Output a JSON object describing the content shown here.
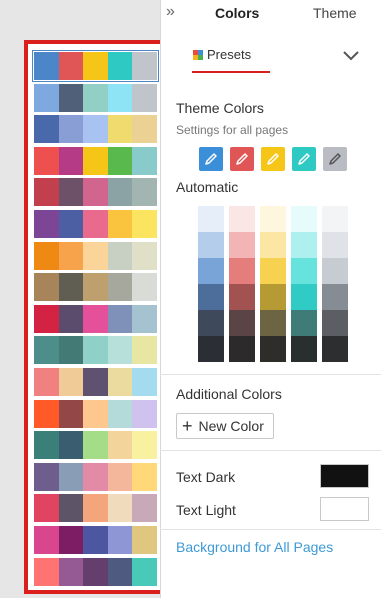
{
  "header": {
    "expand_glyph": "»",
    "tab_colors": "Colors",
    "tab_theme": "Theme"
  },
  "presets": {
    "label": "Presets",
    "icon_colors": [
      "#e84c3d",
      "#3b8fd9",
      "#f2b31b",
      "#4caf50"
    ],
    "rows": [
      [
        "#4a86c8",
        "#e05555",
        "#f5c518",
        "#2ec9c3",
        "#c0c5cc"
      ],
      [
        "#7ea8e0",
        "#4f6078",
        "#92cfc4",
        "#8ee3f5",
        "#c0c5cc"
      ],
      [
        "#4a69aa",
        "#8a9ed6",
        "#a8c3f2",
        "#f0dc6e",
        "#ebd294"
      ],
      [
        "#ee5050",
        "#b53b86",
        "#f5c518",
        "#5ab94c",
        "#89cbca"
      ],
      [
        "#c2404e",
        "#6d5169",
        "#d1658e",
        "#8ba3a4",
        "#a3b5b1"
      ],
      [
        "#7c4595",
        "#4b5fa2",
        "#e96a8c",
        "#fbc43f",
        "#fbe460"
      ],
      [
        "#ee8a14",
        "#f7a34b",
        "#fbd49a",
        "#c7d0c3",
        "#e0e0c8"
      ],
      [
        "#a8845a",
        "#605e52",
        "#bea06e",
        "#a6a89e",
        "#d8dbd6"
      ],
      [
        "#d42342",
        "#5b4c6e",
        "#e4519a",
        "#7f91b9",
        "#a4c2d0"
      ],
      [
        "#4d8e8a",
        "#437a76",
        "#8fd0c9",
        "#b8e0db",
        "#e7e7a3"
      ],
      [
        "#f18080",
        "#f0ca97",
        "#5f5270",
        "#ecdb9e",
        "#a5dbee"
      ],
      [
        "#ff5a28",
        "#934847",
        "#fdc78e",
        "#b4dad9",
        "#cfc2ef"
      ],
      [
        "#3a7f78",
        "#3a5e70",
        "#a4dc87",
        "#f3d49a",
        "#f8f2a0"
      ],
      [
        "#6e5e8e",
        "#899db7",
        "#e38aa6",
        "#f4b79b",
        "#ffd879"
      ],
      [
        "#e04461",
        "#5d5467",
        "#f4a57c",
        "#f0dbbd",
        "#c8a9b8"
      ],
      [
        "#d9468e",
        "#7d1d63",
        "#4c56a1",
        "#8e96d6",
        "#dfc77f"
      ],
      [
        "#ff7373",
        "#955a93",
        "#643f6e",
        "#4e5a80",
        "#49c9b8"
      ]
    ]
  },
  "theme_colors": {
    "title": "Theme Colors",
    "subtitle": "Settings for all pages",
    "buttons": [
      {
        "color": "#3b8fd9",
        "icon": "pencil-icon"
      },
      {
        "color": "#e05555",
        "icon": "pencil-icon"
      },
      {
        "color": "#f5c518",
        "icon": "pencil-icon"
      },
      {
        "color": "#2ec9c3",
        "icon": "pencil-icon"
      },
      {
        "color": "#b9bcc2",
        "icon": "pencil-icon"
      }
    ]
  },
  "automatic": {
    "title": "Automatic",
    "columns": [
      [
        "#e6eef9",
        "#b4cdea",
        "#78a4d8",
        "#4d6e9a",
        "#3e4a5c",
        "#2b2f35"
      ],
      [
        "#fbe6e6",
        "#f2b4b4",
        "#e67d7d",
        "#a35252",
        "#5b4446",
        "#2d2a2b"
      ],
      [
        "#fef6dd",
        "#fbe7a3",
        "#f7d250",
        "#b69a34",
        "#6c6443",
        "#2e2d29"
      ],
      [
        "#e6fbfb",
        "#aef0ee",
        "#67e3dd",
        "#2fcbc4",
        "#3f7c77",
        "#292e2e"
      ],
      [
        "#f3f4f6",
        "#dfe3e8",
        "#c7ccd3",
        "#868c94",
        "#5b5e63",
        "#2d2e30"
      ]
    ]
  },
  "additional": {
    "title": "Additional Colors",
    "new_color_label": "New Color"
  },
  "text_dark": {
    "label": "Text Dark",
    "color": "#111111"
  },
  "text_light": {
    "label": "Text Light",
    "color": "#ffffff"
  },
  "background_link": "Background for All Pages",
  "accent": "#d9201f"
}
